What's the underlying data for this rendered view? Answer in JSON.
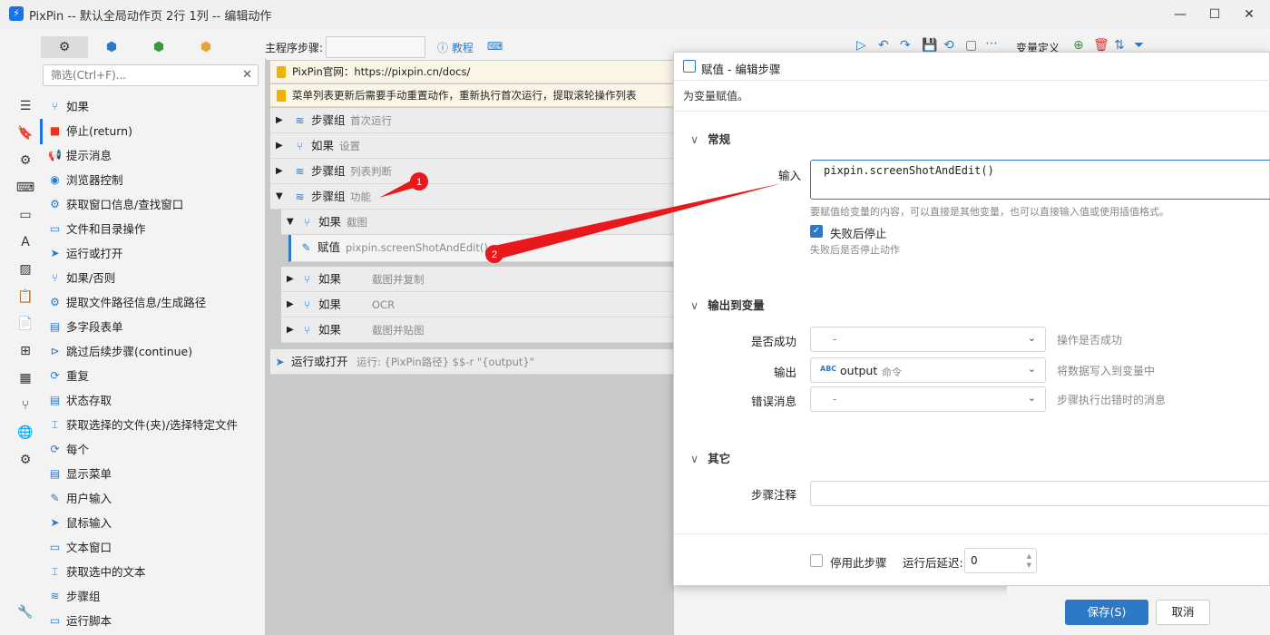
{
  "window": {
    "title": "PixPin -- 默认全局动作页 2行 1列 -- 编辑动作",
    "logo": "PixPin",
    "min": "—",
    "max": "☐",
    "close": "✕"
  },
  "sidebar": {
    "icons": [
      "menu-icon",
      "bookmark-icon",
      "gear-icon",
      "keyboard-icon",
      "window-icon",
      "text-icon",
      "image-icon",
      "clipboard-icon",
      "document-icon",
      "windows-icon",
      "grid-icon",
      "branch-icon",
      "globe-icon",
      "gears-icon",
      "wrench-icon"
    ]
  },
  "left_tabs": [
    "⚙",
    "⬢",
    "⬢",
    "⬢"
  ],
  "filter": {
    "placeholder": "筛选(Ctrl+F)...",
    "clear": "✕"
  },
  "actions": [
    "如果",
    "停止(return)",
    "提示消息",
    "浏览器控制",
    "获取窗口信息/查找窗口",
    "文件和目录操作",
    "运行或打开",
    "如果/否则",
    "提取文件路径信息/生成路径",
    "多字段表单",
    "跳过后续步骤(continue)",
    "重复",
    "状态存取",
    "获取选择的文件(夹)/选择特定文件",
    "每个",
    "显示菜单",
    "用户输入",
    "鼠标输入",
    "文本窗口",
    "获取选中的文本",
    "步骤组",
    "运行脚本"
  ],
  "main_toolbar": {
    "program_step_label": "主程序步骤:",
    "tutorial": "ⓘ 教程",
    "keyboard": "⌨"
  },
  "notes": [
    "PixPin官网：https://pixpin.cn/docs/",
    "菜单列表更新后需要手动重置动作，重新执行首次运行，提取滚轮操作列表"
  ],
  "tree_rows": [
    {
      "name": "步骤组",
      "sub": "首次运行"
    },
    {
      "name": "如果",
      "sub": "设置"
    },
    {
      "name": "步骤组",
      "sub": "列表判断"
    },
    {
      "name": "步骤组",
      "sub": "功能"
    },
    {
      "name": "如果",
      "sub": "截图"
    },
    {
      "name": "赋值",
      "sub": "pixpin.screenShotAndEdit() =>"
    },
    {
      "name": "如果",
      "sub": "截图并复制"
    },
    {
      "name": "如果",
      "sub": "OCR"
    },
    {
      "name": "如果",
      "sub": "截图并贴图"
    },
    {
      "name": "运行或打开",
      "sub": "运行:  {PixPin路径} $$-r \"{output}\""
    }
  ],
  "annotations": [
    "1",
    "2"
  ],
  "top_right": {
    "var_def": "变量定义"
  },
  "dialog": {
    "title": "赋值  -  编辑步骤",
    "desc": "为变量赋值。",
    "sec_general": "常规",
    "input_label": "输入",
    "input_value": "pixpin.screenShotAndEdit()",
    "input_hint": "要赋值给变量的内容，可以直接是其他变量，也可以直接输入值或使用插值格式。",
    "stop_on_fail": "失败后停止",
    "stop_on_fail_hint": "失败后是否停止动作",
    "sec_output": "输出到变量",
    "success_label": "是否成功",
    "success_value": "-",
    "success_hint": "操作是否成功",
    "output_label": "输出",
    "output_badge": "ABC",
    "output_value": "output",
    "output_type": "命令",
    "output_hint": "将数据写入到变量中",
    "error_label": "错误消息",
    "error_value": "-",
    "error_hint": "步骤执行出错时的消息",
    "sec_other": "其它",
    "note_label": "步骤注释",
    "disable_step": "停用此步骤",
    "delay_label": "运行后延迟:",
    "delay_value": "0"
  },
  "buttons": {
    "save": "保存(S)",
    "cancel": "取消"
  }
}
